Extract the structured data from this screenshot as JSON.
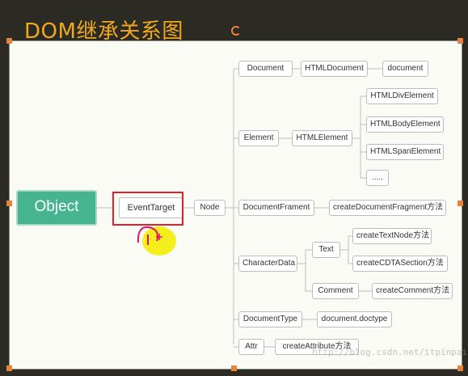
{
  "title": "DOM继承关系图",
  "watermark": "http://blog.csdn.net/itpinpai",
  "colors": {
    "title": "#f2a81e",
    "object_fill": "#46b58f",
    "highlight": "#e3202a",
    "handle": "#e8843a"
  },
  "nodes": {
    "object": "Object",
    "event_target": "EventTarget",
    "node": "Node",
    "document": "Document",
    "html_document": "HTMLDocument",
    "document_leaf": "document",
    "element": "Element",
    "html_element": "HTMLElement",
    "html_div_element": "HTMLDivElement",
    "html_body_element": "HTMLBodyElement",
    "html_span_element": "HTMLSpanElement",
    "html_more": ".....",
    "document_frament": "DocumentFrament",
    "create_document_fragment": "createDocumentFragment方法",
    "character_data": "CharacterData",
    "text": "Text",
    "create_text_node": "createTextNode方法",
    "create_cdata_section": "createCDTASection方法",
    "comment": "Comment",
    "create_comment": "createComment方法",
    "document_type": "DocumentType",
    "document_doctype": "document.doctype",
    "attr": "Attr",
    "create_attribute": "createAttribute方法"
  }
}
